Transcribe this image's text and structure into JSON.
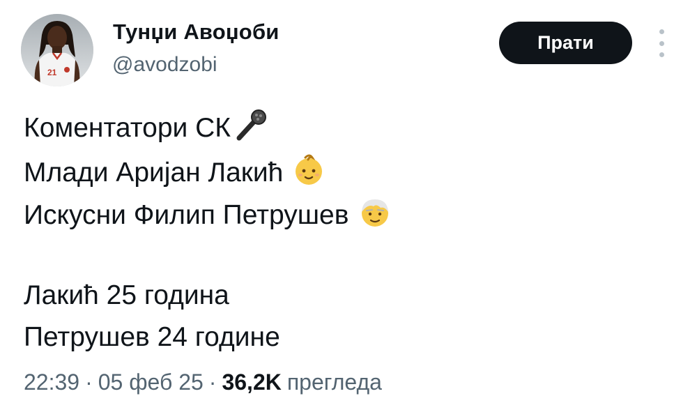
{
  "author": {
    "display_name": "Тунџи Авоџоби",
    "handle": "@avodzobi",
    "avatar_jersey_number": "21"
  },
  "actions": {
    "follow_label": "Прати"
  },
  "tweet": {
    "line1": "Коментатори СК",
    "line1_emoji": "microphone-icon",
    "line2": "Млади Аријан Лакић",
    "line2_emoji": "baby-icon",
    "line3": "Искусни Филип Петрушев",
    "line3_emoji": "old-man-icon",
    "line5": "Лакић 25 година",
    "line6": "Петрушев 24 године"
  },
  "meta": {
    "time": "22:39",
    "separator": "·",
    "date": "05 феб 25",
    "views_count": "36,2K",
    "views_label": "прегледа"
  },
  "colors": {
    "text": "#0f1419",
    "secondary": "#536471",
    "button_bg": "#0f1419",
    "button_text": "#ffffff",
    "dots": "#b9c2c9"
  }
}
